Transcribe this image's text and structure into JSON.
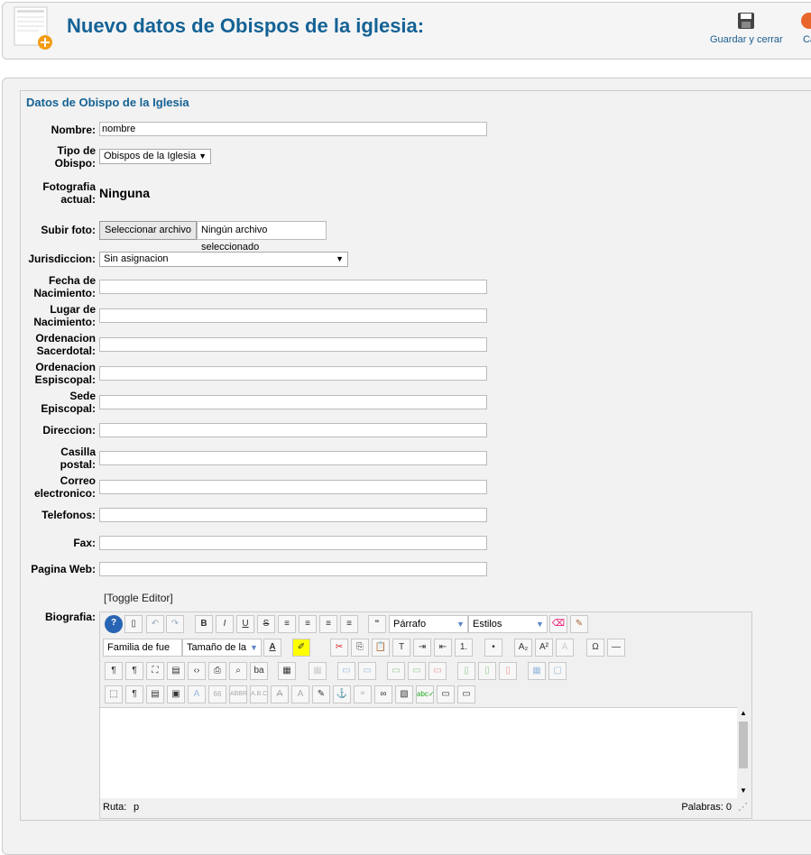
{
  "header": {
    "title": "Nuevo datos de Obispos de la iglesia:",
    "icon": "article-add-icon"
  },
  "toolbar": {
    "save_close": "Guardar y cerrar",
    "cancel": "Ca"
  },
  "form": {
    "legend": "Datos de Obispo de la Iglesia",
    "nombre": {
      "label": "Nombre:",
      "value": "nombre"
    },
    "tipo": {
      "label1": "Tipo de",
      "label2": "Obispo:",
      "value": "Obispos de la Iglesia"
    },
    "foto": {
      "label1": "Fotografia",
      "label2": "actual:",
      "value": "Ninguna"
    },
    "subir": {
      "label": "Subir foto:",
      "button": "Seleccionar archivo",
      "status": "Ningún archivo seleccionado"
    },
    "jurisdiccion": {
      "label": "Jurisdiccion:",
      "value": "Sin asignacion"
    },
    "fecha": {
      "label1": "Fecha de",
      "label2": "Nacimiento:"
    },
    "lugar": {
      "label1": "Lugar de",
      "label2": "Nacimiento:"
    },
    "ord_sac": {
      "label1": "Ordenacion",
      "label2": "Sacerdotal:"
    },
    "ord_epi": {
      "label1": "Ordenacion",
      "label2": "Espiscopal:"
    },
    "sede": {
      "label1": "Sede",
      "label2": "Episcopal:"
    },
    "direccion": {
      "label": "Direccion:"
    },
    "casilla": {
      "label1": "Casilla",
      "label2": "postal:"
    },
    "correo": {
      "label1": "Correo",
      "label2": "electronico:"
    },
    "telefonos": {
      "label": "Telefonos:"
    },
    "fax": {
      "label": "Fax:"
    },
    "web": {
      "label": "Pagina Web:"
    },
    "toggle": "[Toggle Editor]",
    "bio": {
      "label": "Biografia:"
    }
  },
  "editor": {
    "format": "Párrafo",
    "styles": "Estilos",
    "font_family": "Familia de fue",
    "font_size": "Tamaño de la",
    "path_label": "Ruta:",
    "path_value": "p",
    "words": "Palabras: 0"
  }
}
